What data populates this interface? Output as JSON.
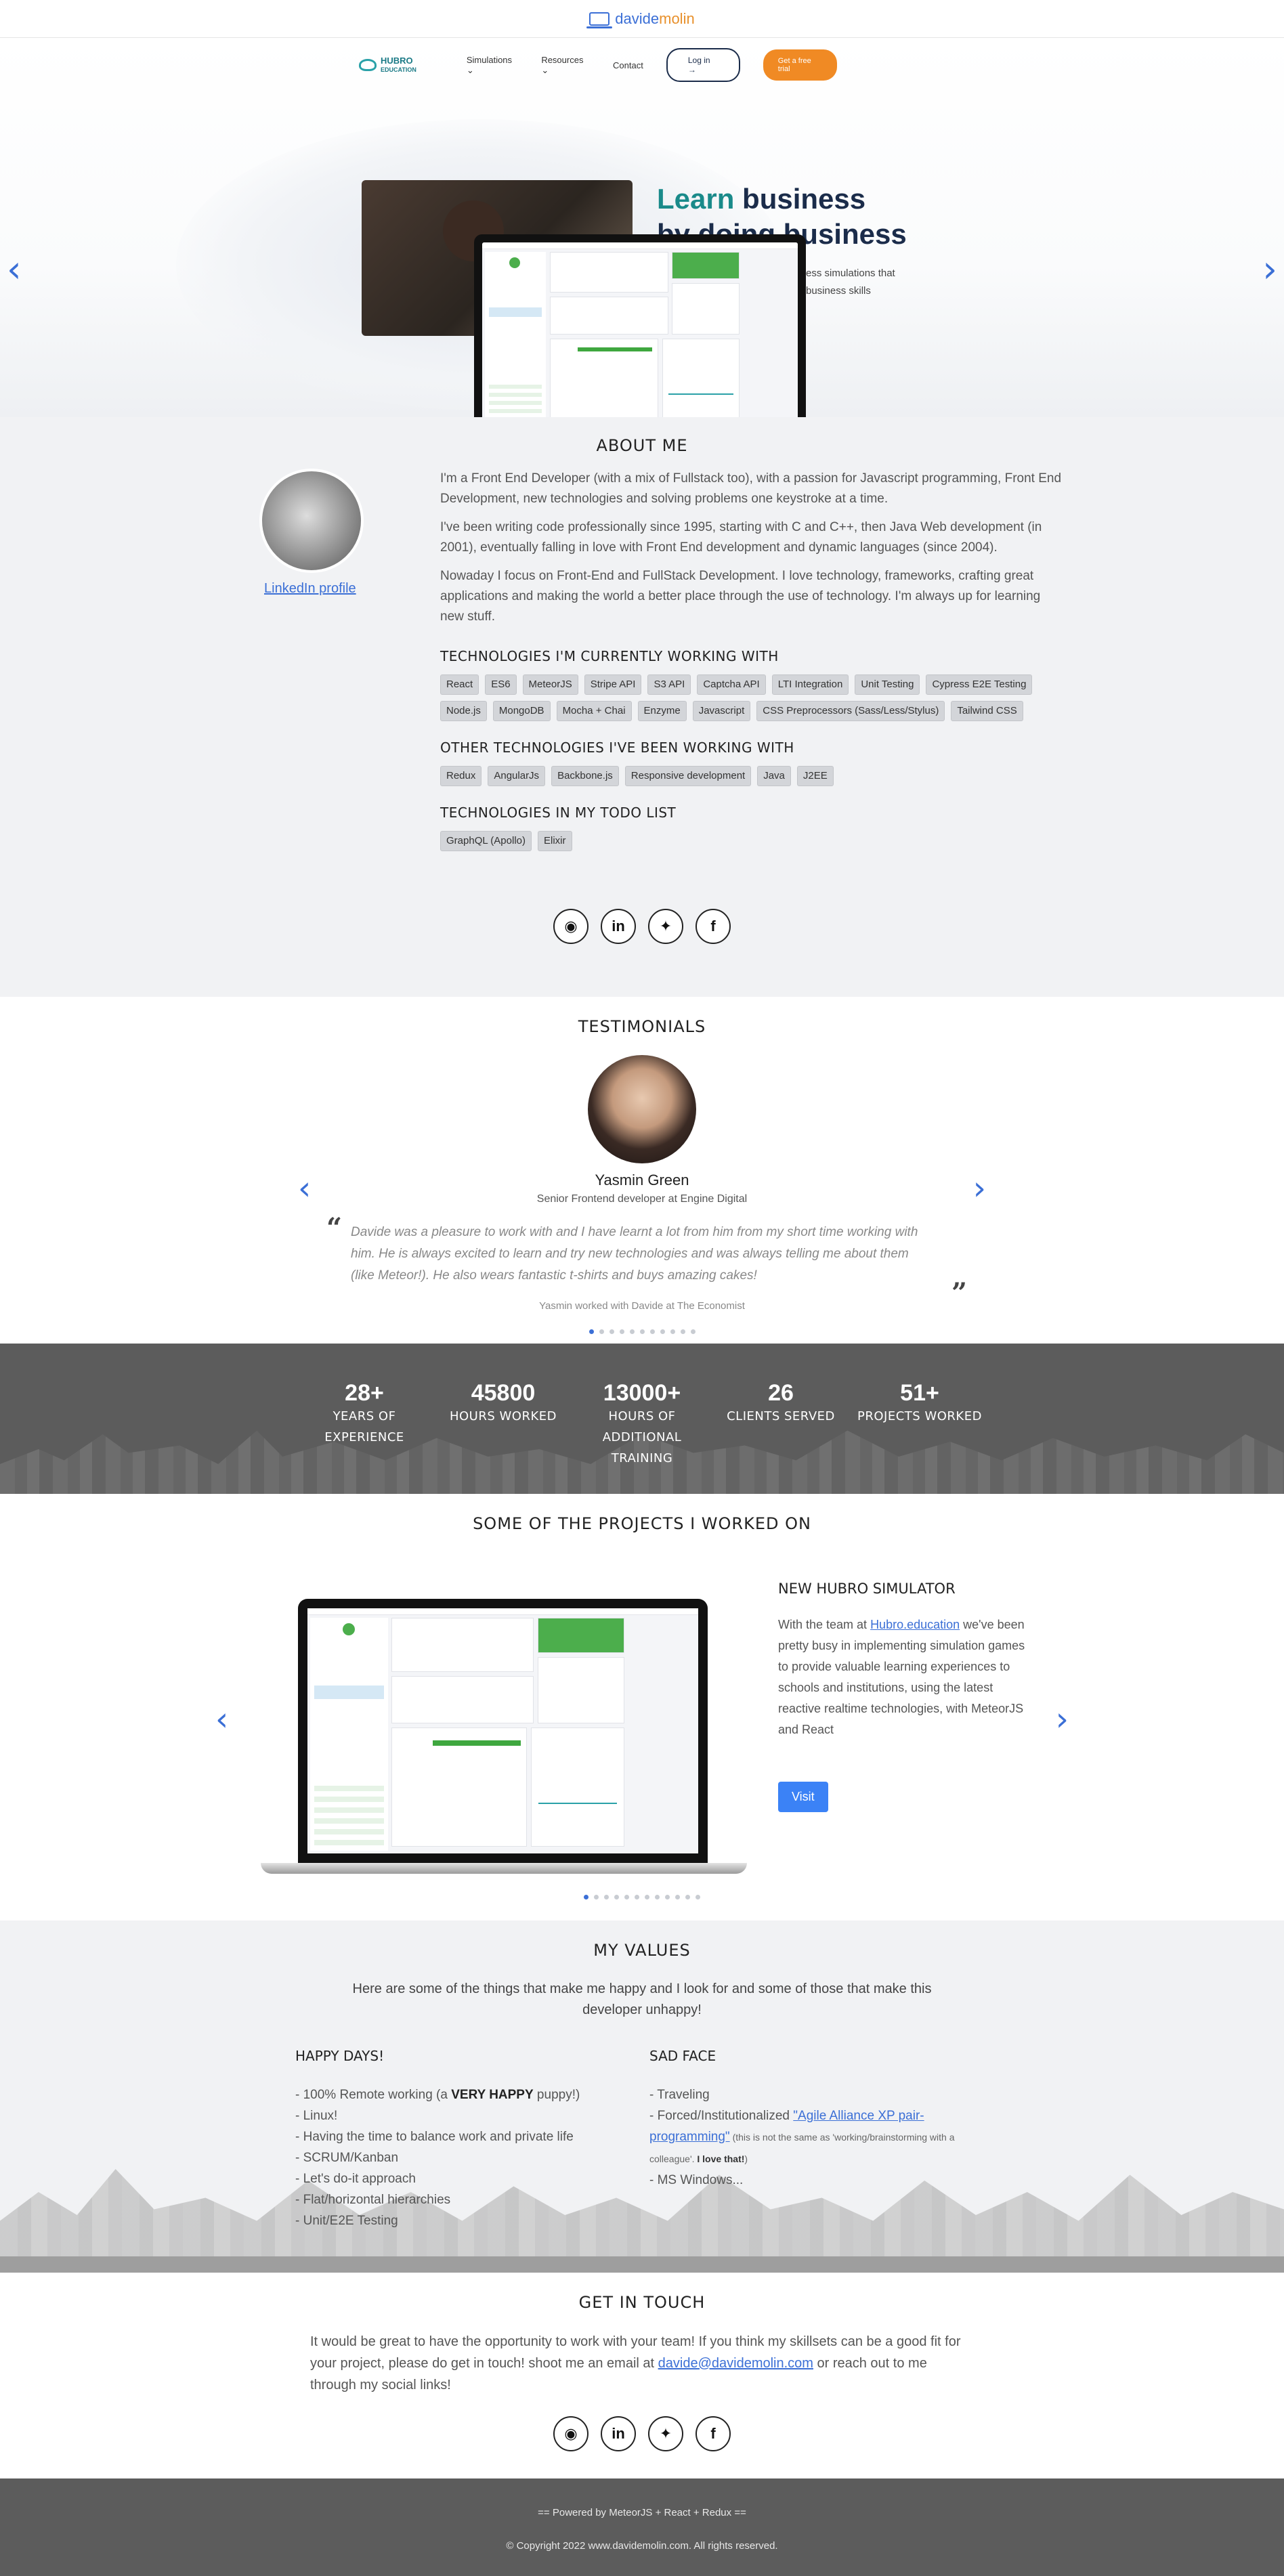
{
  "top": {
    "logo_first": "davide",
    "logo_second": "molin"
  },
  "hero": {
    "nav": {
      "brand": "HUBRO",
      "brand_sub": "EDUCATION",
      "items": [
        "Simulations",
        "Resources",
        "Contact"
      ],
      "login": "Log in",
      "trial": "Get a free trial"
    },
    "title_green": "Learn",
    "title_rest": "business",
    "title_line2": "by doing business",
    "sub_line1": "ess simulations that",
    "sub_line2": "business skills",
    "slide_count": 11,
    "active_slide": 0,
    "colors": {
      "accent": "#3b6fd6",
      "trial": "#f08a24",
      "brand": "#1a8a8a"
    }
  },
  "about": {
    "title": "ABOUT ME",
    "linkedin": "LinkedIn profile",
    "p1": "I'm a Front End Developer (with a mix of Fullstack too), with a passion for Javascript programming, Front End Development, new technologies and solving problems one keystroke at a time.",
    "p2": "I've been writing code professionally since 1995, starting with C and C++, then Java Web development (in 2001), eventually falling in love with Front End development and dynamic languages (since 2004).",
    "p3": "Nowaday I focus on Front-End and FullStack Development. I love technology, frameworks, crafting great applications and making the world a better place through the use of technology. I'm always up for learning new stuff.",
    "current_title": "TECHNOLOGIES I'M CURRENTLY WORKING WITH",
    "current": [
      "React",
      "ES6",
      "MeteorJS",
      "Stripe API",
      "S3 API",
      "Captcha API",
      "LTI Integration",
      "Unit Testing",
      "Cypress E2E Testing",
      "Node.js",
      "MongoDB",
      "Mocha + Chai",
      "Enzyme",
      "Javascript",
      "CSS Preprocessors (Sass/Less/Stylus)",
      "Tailwind CSS"
    ],
    "other_title": "OTHER TECHNOLOGIES I'VE BEEN WORKING WITH",
    "other": [
      "Redux",
      "AngularJs",
      "Backbone.js",
      "Responsive development",
      "Java",
      "J2EE"
    ],
    "todo_title": "TECHNOLOGIES IN MY TODO LIST",
    "todo": [
      "GraphQL (Apollo)",
      "Elixir"
    ],
    "socials": [
      "github-icon",
      "linkedin-icon",
      "twitter-icon",
      "facebook-icon"
    ]
  },
  "testimonials": {
    "title": "TESTIMONIALS",
    "name": "Yasmin Green",
    "role": "Senior Frontend developer at Engine Digital",
    "quote": "Davide was a pleasure to work with and I have learnt a lot from him from my short time working with him. He is always excited to learn and try new technologies and was always telling me about them (like Meteor!). He also wears fantastic t-shirts and buys amazing cakes!",
    "worked": "Yasmin worked with Davide at The Economist",
    "slide_count": 11,
    "active_slide": 0
  },
  "stats": [
    {
      "number": "28+",
      "label_lines": [
        "YEARS OF",
        "EXPERIENCE"
      ]
    },
    {
      "number": "45800",
      "label_lines": [
        "HOURS WORKED"
      ]
    },
    {
      "number": "13000+",
      "label_lines": [
        "HOURS OF",
        "ADDITIONAL",
        "TRAINING"
      ]
    },
    {
      "number": "26",
      "label_lines": [
        "CLIENTS SERVED"
      ]
    },
    {
      "number": "51+",
      "label_lines": [
        "PROJECTS WORKED"
      ]
    }
  ],
  "projects": {
    "title": "SOME OF THE PROJECTS I WORKED ON",
    "item_title": "NEW HUBRO SIMULATOR",
    "desc_pre": "With the team at ",
    "desc_link": "Hubro.education",
    "desc_post": " we've been pretty busy in implementing simulation games to provide valuable learning experiences to schools and institutions, using the latest reactive realtime technologies, with MeteorJS and React",
    "visit": "Visit",
    "slide_count": 12,
    "active_slide": 0
  },
  "values": {
    "title": "MY VALUES",
    "intro": "Here are some of the things that make me happy and I look for and some of those that make this developer unhappy!",
    "happy_title": "HAPPY DAYS!",
    "happy": [
      "100% Remote working (a VERY HAPPY puppy!)",
      "Linux!",
      "Having the time to balance work and private life",
      "SCRUM/Kanban",
      "Let's do-it approach",
      "Flat/horizontal hierarchies",
      "Unit/E2E Testing"
    ],
    "sad_title": "SAD FACE",
    "sad_1": "Traveling",
    "sad_2_pre": "Forced/Institutionalized ",
    "sad_2_link": "\"Agile Alliance XP pair-programming\"",
    "sad_2_small": " (this is not the same as 'working/brainstorming with a colleague'. ",
    "sad_2_bold": "I love that!",
    "sad_2_end": ")",
    "sad_3": "MS Windows..."
  },
  "contact": {
    "title": "GET IN TOUCH",
    "pre": "It would be great to have the opportunity to work with your team! If you think my skillsets can be a good fit for your project, please do get in touch! shoot me an email at ",
    "email": "davide@davidemolin.com",
    "post": " or reach out to me through my social links!"
  },
  "footer": {
    "powered": "== Powered by MeteorJS + React + Redux ==",
    "copyright": "© Copyright 2022 www.davidemolin.com. All rights reserved."
  }
}
